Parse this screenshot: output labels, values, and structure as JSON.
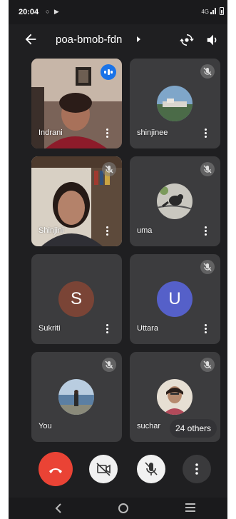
{
  "status_bar": {
    "time": "20:04",
    "left_icons": "○ ▶",
    "network": "4G"
  },
  "header": {
    "meeting_code": "poa-bmob-fdn"
  },
  "participants": [
    {
      "name": "Indrani",
      "speaking": true,
      "muted": false,
      "kind": "video"
    },
    {
      "name": "shinjinee",
      "speaking": false,
      "muted": true,
      "kind": "photo"
    },
    {
      "name": "Shinjini",
      "speaking": false,
      "muted": true,
      "kind": "video"
    },
    {
      "name": "uma",
      "speaking": false,
      "muted": true,
      "kind": "photo"
    },
    {
      "name": "Sukriti",
      "initial": "S",
      "avatar_color": "#7a4436",
      "muted": false,
      "kind": "letter"
    },
    {
      "name": "Uttara",
      "initial": "U",
      "avatar_color": "#5560c9",
      "muted": true,
      "kind": "letter"
    },
    {
      "name": "You",
      "muted": true,
      "kind": "photo"
    },
    {
      "name": "suchar",
      "muted": true,
      "kind": "photo"
    }
  ],
  "others_pill": "24 others",
  "controls": {
    "end_call": "end-call",
    "camera": "camera-off",
    "microphone": "mic-off",
    "more": "more-options"
  },
  "colors": {
    "end_call": "#ea4335",
    "speaking_badge": "#1a73e8",
    "background": "#1f1f21",
    "tile": "#3c3c3e"
  }
}
